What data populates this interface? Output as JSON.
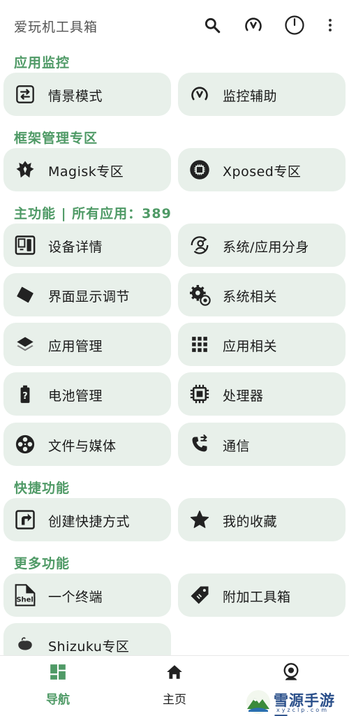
{
  "app": {
    "title": "爱玩机工具箱",
    "actions": [
      {
        "name": "search",
        "icon": "search-icon"
      },
      {
        "name": "monitor",
        "icon": "gauge-icon"
      },
      {
        "name": "power",
        "icon": "power-icon"
      },
      {
        "name": "more",
        "icon": "more-vert-icon"
      }
    ]
  },
  "sections": {
    "monitor": "应用监控",
    "framework": "框架管理专区",
    "main": "主功能 | 所有应用：389",
    "shortcuts": "快捷功能",
    "more": "更多功能"
  },
  "cards": {
    "scene_mode": "情景模式",
    "monitor_assist": "监控辅助",
    "magisk": "Magisk专区",
    "xposed": "Xposed专区",
    "device_info": "设备详情",
    "app_clone": "系统/应用分身",
    "display_adjust": "界面显示调节",
    "system_related": "系统相关",
    "app_manage": "应用管理",
    "app_related": "应用相关",
    "battery": "电池管理",
    "processor": "处理器",
    "files_media": "文件与媒体",
    "communication": "通信",
    "create_shortcut": "创建快捷方式",
    "favorites": "我的收藏",
    "terminal": "一个终端",
    "extra_tools": "附加工具箱",
    "shizuku": "Shizuku专区"
  },
  "nav": {
    "navigation": "导航",
    "home": "主页",
    "profile": ""
  },
  "watermark": {
    "text": "雪源手游网",
    "sub": "xyzclp.com"
  },
  "colors": {
    "accent": "#4f9a66",
    "card_bg": "#e8f0ea",
    "text": "#1a1a1a"
  }
}
